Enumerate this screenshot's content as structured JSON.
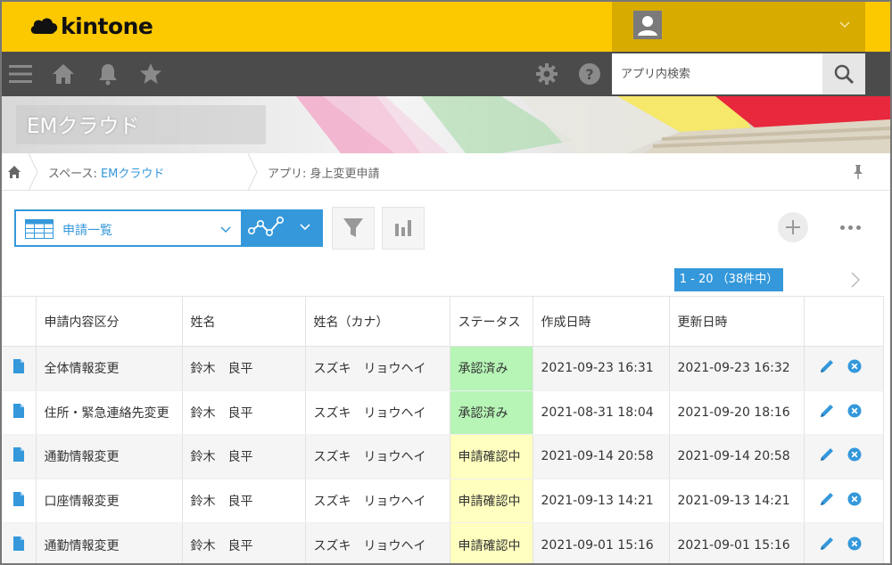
{
  "header": {
    "logo_text": "kintone",
    "colors": {
      "brand_yellow": "#fcc800",
      "user_area": "#d8ab00",
      "nav_dark": "#4b4b4b",
      "accent_blue": "#3498db"
    }
  },
  "nav": {
    "search_placeholder": "アプリ内検索"
  },
  "banner": {
    "title": "EMクラウド"
  },
  "breadcrumb": {
    "space_prefix": "スペース: ",
    "space_name": "EMクラウド",
    "app_text": "アプリ: 身上変更申請"
  },
  "toolbar": {
    "view_name": "申請一覧"
  },
  "pager": {
    "info": "1 - 20 （38件中）"
  },
  "table": {
    "columns": [
      "申請内容区分",
      "姓名",
      "姓名（カナ）",
      "ステータス",
      "作成日時",
      "更新日時"
    ],
    "rows": [
      {
        "category": "全体情報変更",
        "name": "鈴木　良平",
        "kana": "スズキ　リョウヘイ",
        "status": "承認済み",
        "status_type": "approved",
        "created": "2021-09-23 16:31",
        "updated": "2021-09-23 16:32"
      },
      {
        "category": "住所・緊急連絡先変更",
        "name": "鈴木　良平",
        "kana": "スズキ　リョウヘイ",
        "status": "承認済み",
        "status_type": "approved",
        "created": "2021-08-31 18:04",
        "updated": "2021-09-20 18:16"
      },
      {
        "category": "通勤情報変更",
        "name": "鈴木　良平",
        "kana": "スズキ　リョウヘイ",
        "status": "申請確認中",
        "status_type": "pending",
        "created": "2021-09-14 20:58",
        "updated": "2021-09-14 20:58"
      },
      {
        "category": "口座情報変更",
        "name": "鈴木　良平",
        "kana": "スズキ　リョウヘイ",
        "status": "申請確認中",
        "status_type": "pending",
        "created": "2021-09-13 14:21",
        "updated": "2021-09-13 14:21"
      },
      {
        "category": "通勤情報変更",
        "name": "鈴木　良平",
        "kana": "スズキ　リョウヘイ",
        "status": "申請確認中",
        "status_type": "pending",
        "created": "2021-09-01 15:16",
        "updated": "2021-09-01 15:16"
      }
    ]
  }
}
